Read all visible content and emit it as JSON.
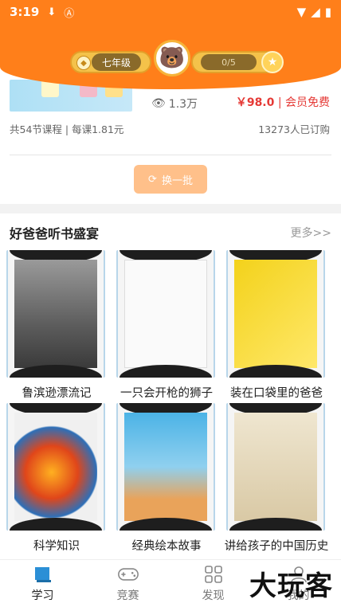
{
  "status": {
    "time": "3:19",
    "icons": [
      "download-icon",
      "a-icon",
      "wifi-icon",
      "signal-icon",
      "battery-icon"
    ]
  },
  "level": {
    "grade": "七年级",
    "progress": "0/5"
  },
  "course": {
    "views": "1.3万",
    "price": "￥98.0",
    "member_label": "会员免费",
    "lessons_info": "共54节课程 | 每课1.81元",
    "subscribers": "13273人已订购",
    "refresh_label": "换一批"
  },
  "section": {
    "title": "好爸爸听书盛宴",
    "more_label": "更多>>",
    "books": [
      {
        "title": "鲁滨逊漂流记"
      },
      {
        "title": "一只会开枪的狮子"
      },
      {
        "title": "装在口袋里的爸爸"
      },
      {
        "title": "科学知识"
      },
      {
        "title": "经典绘本故事"
      },
      {
        "title": "讲给孩子的中国历史"
      }
    ]
  },
  "nav": {
    "items": [
      {
        "label": "学习",
        "icon": "book-icon",
        "active": true
      },
      {
        "label": "竞赛",
        "icon": "gamepad-icon",
        "active": false
      },
      {
        "label": "发现",
        "icon": "grid-icon",
        "active": false
      },
      {
        "label": "我的",
        "icon": "user-icon",
        "active": false
      }
    ]
  },
  "watermark": "大玩客",
  "colors": {
    "brand": "#ff7f1a",
    "price": "#e53935",
    "refresh_button": "#ffc08a"
  }
}
